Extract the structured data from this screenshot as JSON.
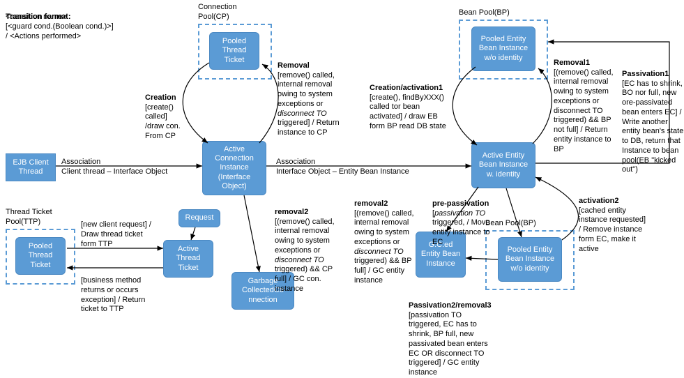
{
  "header": {
    "title": "Transition format:",
    "line2": "<transition name>",
    "line3": "[<guard cond.(Boolean cond.)>]",
    "line4": "/ <Actions performed>"
  },
  "pools": {
    "cp_label": "Connection\nPool(CP)",
    "bp_label_top": "Bean Pool(BP)",
    "bp_label_bottom": "Bean Pool(BP)",
    "ttp_label": "Thread Ticket\nPool(TTP)"
  },
  "nodes": {
    "ejb_client": "EJB Client\nThread",
    "pooled_thread_ticket_cp": "Pooled\nThread\nTicket",
    "active_conn": "Active\nConnection\nInstance\n(Interface\nObject)",
    "pooled_eb_top": "Pooled\nEntity Bean\nInstance w/o\nidentity",
    "active_eb": "Active\nEntity Bean\nInstance w.\nidentity",
    "request": "Request",
    "active_thread_ticket": "Active\nThread\nTicket",
    "pooled_thread_ticket_ttp": "Pooled\nThread\nTicket",
    "gc_connection": "Garbage\nCollectedCo\nnnection",
    "gc_entity": "G.C:ed\nEntity\nBean\nInstance",
    "pooled_eb_bottom": "Pooled\nEntity Bean\nInstance w/o\nidentity"
  },
  "edges": {
    "assoc1_label": "Association",
    "assoc1_desc": "Client thread – Interface Object",
    "assoc2_label": "Association",
    "assoc2_desc": "Interface Object – Entity Bean Instance",
    "creation_title": "Creation",
    "creation_body": "[create()\ncalled]\n/draw con.\nFrom CP",
    "removal_title": "Removal",
    "removal_body": "[remove() called,\ninternal removal\nowing to system\nexceptions or\n<i>disconnect TO</i>\ntriggered] / Return\ninstance to CP",
    "creation_act_title": "Creation/activation1",
    "creation_act_body": "[create(), findByXXX()\ncalled tor bean\nactivated] / draw EB\nform BP read DB state",
    "removal1_title": "Removal1",
    "removal1_body": "[(remove() called,\ninternal removal\nowing to system\nexceptions or\ndisconnect TO\ntriggered) && BP\nnot full] / Return\nentity instance to\nBP",
    "passivation1_title": "Passivation1",
    "passivation1_body": "[EC has to shrink,\nBO nor full, new\nore-passivated\nbean enters EC] /\nWrite another\nentity bean's state\nto DB, return that\nInstance to bean\npool(EB \"kicked\nout\")",
    "removal2_title": "removal2",
    "removal2_body": "[(remove() called,\ninternal removal\nowing to system\nexceptions or\n<i>disconnect TO</i>\ntriggered) && CP\nfull] / GC con.\ninstance",
    "removal2_eb_title": "removal2",
    "removal2_eb_body": "[(remove() called,\ninternal removal\nowing to system\nexceptions or\n<i>disconnect TO</i>\ntriggered) && BP\nfull] / GC entity\ninstance",
    "prepass_title": "pre-passivation",
    "prepass_body": "[<i>passivation TO</i>\ntriggered, / Move\nentity instance to\nEC",
    "activation2_title": "activation2",
    "activation2_body": "[cached entity\ninstance requested]\n/ Remove instance\nform EC, make it\nactive",
    "pass2_title": "Passivation2/removal3",
    "pass2_body": "[passivation TO\ntriggered, EC has to\nshrink, BP full, new\npassivated bean enters\nEC OR disconnect TO\ntriggered] / GC entity\ninstance",
    "ttp_new_body": "[new client request] /\nDraw thread ticket\nform TTP",
    "ttp_return_body": "[business method\nreturns or occurs\nexception] / Return\nticket to TTP"
  }
}
